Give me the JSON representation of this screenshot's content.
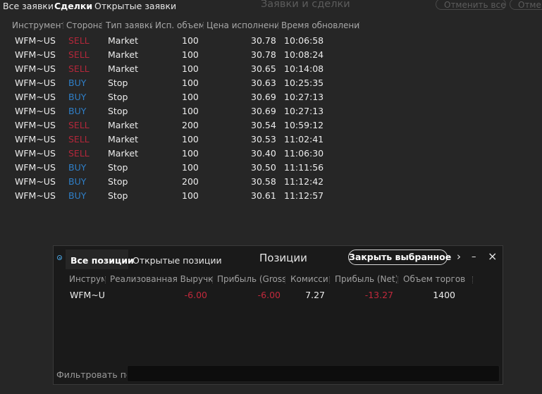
{
  "top_tabs": [
    {
      "label": "Все заявки",
      "active": false
    },
    {
      "label": "Сделки",
      "active": true
    },
    {
      "label": "Открытые заявки",
      "active": false
    }
  ],
  "window_title": "Заявки и сделки",
  "cancel_all_label": "Отменить все",
  "cancel_label": "Отмен",
  "table": {
    "headers": [
      "Инструмент",
      "Сторона",
      "Тип заявки",
      "Исп. объем",
      "Цена исполнения",
      "Время обновления"
    ],
    "rows": [
      {
        "instrument": "WFM~US",
        "side": "SELL",
        "type": "Market",
        "qty": "100",
        "price": "30.78",
        "time": "10:06:58"
      },
      {
        "instrument": "WFM~US",
        "side": "SELL",
        "type": "Market",
        "qty": "100",
        "price": "30.78",
        "time": "10:08:24"
      },
      {
        "instrument": "WFM~US",
        "side": "SELL",
        "type": "Market",
        "qty": "100",
        "price": "30.65",
        "time": "10:14:08"
      },
      {
        "instrument": "WFM~US",
        "side": "BUY",
        "type": "Stop",
        "qty": "100",
        "price": "30.63",
        "time": "10:25:35"
      },
      {
        "instrument": "WFM~US",
        "side": "BUY",
        "type": "Stop",
        "qty": "100",
        "price": "30.69",
        "time": "10:27:13"
      },
      {
        "instrument": "WFM~US",
        "side": "BUY",
        "type": "Stop",
        "qty": "100",
        "price": "30.69",
        "time": "10:27:13"
      },
      {
        "instrument": "WFM~US",
        "side": "SELL",
        "type": "Market",
        "qty": "200",
        "price": "30.54",
        "time": "10:59:12"
      },
      {
        "instrument": "WFM~US",
        "side": "SELL",
        "type": "Market",
        "qty": "100",
        "price": "30.53",
        "time": "11:02:41"
      },
      {
        "instrument": "WFM~US",
        "side": "SELL",
        "type": "Market",
        "qty": "100",
        "price": "30.40",
        "time": "11:06:30"
      },
      {
        "instrument": "WFM~US",
        "side": "BUY",
        "type": "Stop",
        "qty": "100",
        "price": "30.50",
        "time": "11:11:56"
      },
      {
        "instrument": "WFM~US",
        "side": "BUY",
        "type": "Stop",
        "qty": "200",
        "price": "30.58",
        "time": "11:12:42"
      },
      {
        "instrument": "WFM~US",
        "side": "BUY",
        "type": "Stop",
        "qty": "100",
        "price": "30.61",
        "time": "11:12:57"
      }
    ]
  },
  "positions_panel": {
    "tabs": [
      {
        "label": "Все позиции",
        "active": true
      },
      {
        "label": "Открытые позиции",
        "active": false
      }
    ],
    "title": "Позиции",
    "close_selected_label": "Закрыть выбранное",
    "chevron_glyph": "›",
    "minimize_glyph": "–",
    "close_glyph": "×",
    "headers": [
      "Инструме",
      "Реализованная Выручка",
      "Прибыль (Gross)",
      "Комисси",
      "Прибыль (Net)",
      "Объем торгов"
    ],
    "rows": [
      {
        "instrument": "WFM~U",
        "realized": "-6.00",
        "gross": "-6.00",
        "commission": "7.27",
        "net": "-13.27",
        "volume": "1400"
      }
    ],
    "filter_label": "Фильтровать по",
    "filter_value": ""
  },
  "colors": {
    "sell": "#b3273a",
    "buy": "#2f7fc8",
    "negative": "#c2293c",
    "accent_radio": "#4aa3df"
  }
}
